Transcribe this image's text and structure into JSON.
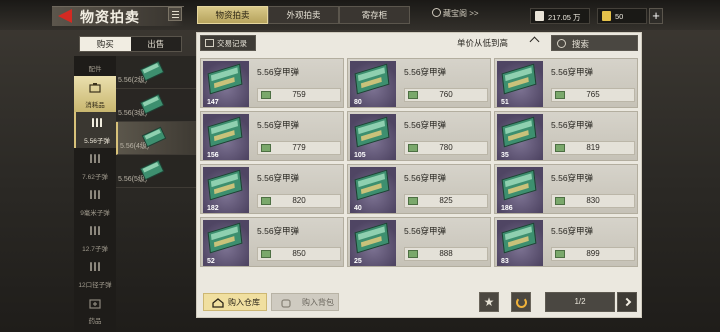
{
  "header": {
    "title": "物资拍卖",
    "tabs": [
      {
        "label": "物资拍卖",
        "active": true
      },
      {
        "label": "外观拍卖",
        "active": false
      },
      {
        "label": "寄存柜",
        "active": false
      }
    ],
    "vault_label": "藏宝阁 >>",
    "money": "217.05 万",
    "gold": "50",
    "plus": "+"
  },
  "mode": {
    "buy": "购买",
    "sell": "出售"
  },
  "categories": [
    {
      "label": "配件",
      "icon": "attachment-icon"
    },
    {
      "label": "消耗品",
      "icon": "consumable-icon",
      "active": true
    },
    {
      "label": "5.56子弹",
      "icon": "bullets-icon",
      "selected": true
    },
    {
      "label": "7.62子弹",
      "icon": "bullets-icon"
    },
    {
      "label": "9毫米子弹",
      "icon": "bullets-icon"
    },
    {
      "label": "12.7子弹",
      "icon": "bullets-icon"
    },
    {
      "label": "12口径子弹",
      "icon": "bullets-icon"
    },
    {
      "label": "药品",
      "icon": "medicine-box-icon"
    }
  ],
  "subtypes": [
    {
      "label": "5.56(2级)"
    },
    {
      "label": "5.56(3级)"
    },
    {
      "label": "5.56(4级)",
      "selected": true
    },
    {
      "label": "5.56(5级)"
    }
  ],
  "toolbar": {
    "trade_record": "交易记录",
    "sort": "单价从低到高",
    "search": "搜索"
  },
  "items": [
    {
      "name": "5.56穿甲弹",
      "qty": "147",
      "price": "759"
    },
    {
      "name": "5.56穿甲弹",
      "qty": "80",
      "price": "760"
    },
    {
      "name": "5.56穿甲弹",
      "qty": "51",
      "price": "765"
    },
    {
      "name": "5.56穿甲弹",
      "qty": "156",
      "price": "779"
    },
    {
      "name": "5.56穿甲弹",
      "qty": "105",
      "price": "780"
    },
    {
      "name": "5.56穿甲弹",
      "qty": "35",
      "price": "819"
    },
    {
      "name": "5.56穿甲弹",
      "qty": "182",
      "price": "820"
    },
    {
      "name": "5.56穿甲弹",
      "qty": "40",
      "price": "825"
    },
    {
      "name": "5.56穿甲弹",
      "qty": "186",
      "price": "830"
    },
    {
      "name": "5.56穿甲弹",
      "qty": "52",
      "price": "850"
    },
    {
      "name": "5.56穿甲弹",
      "qty": "25",
      "price": "888"
    },
    {
      "name": "5.56穿甲弹",
      "qty": "83",
      "price": "899"
    }
  ],
  "footer": {
    "buy_to_warehouse": "购入仓库",
    "buy_to_backpack": "购入背包",
    "page": "1/2"
  },
  "colors": {
    "accent_gold": "#d9c989",
    "back_arrow_red": "#d42a22",
    "refresh_orange": "#f0b23a",
    "item_thumb_purple": "#5c5275"
  }
}
